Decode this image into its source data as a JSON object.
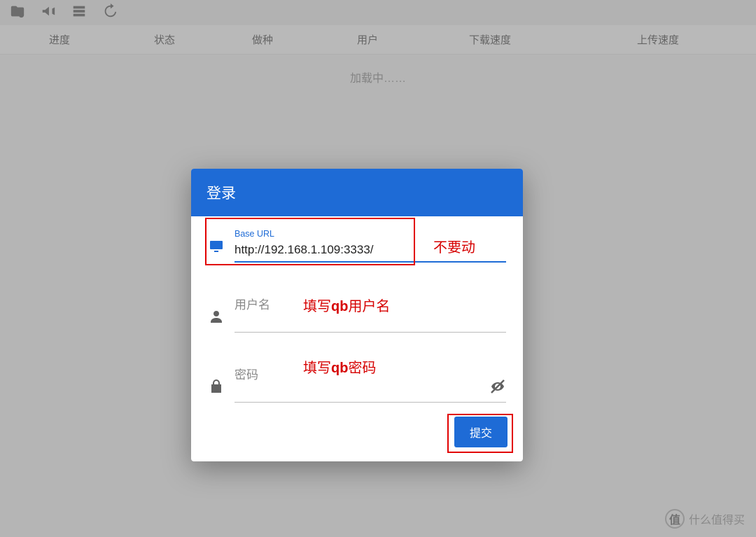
{
  "toolbar": {
    "icons": [
      "folder-pin-icon",
      "megaphone-icon",
      "server-icon",
      "history-icon"
    ]
  },
  "columns": {
    "progress": "进度",
    "status": "状态",
    "seed": "做种",
    "user": "用户",
    "download_speed": "下载速度",
    "upload_speed": "上传速度"
  },
  "loading_text": "加载中……",
  "dialog": {
    "title": "登录",
    "url_field": {
      "label": "Base URL",
      "value": "http://192.168.1.109:3333/"
    },
    "user_field": {
      "label": "用户名",
      "value": ""
    },
    "password_field": {
      "label": "密码",
      "value": ""
    },
    "submit_label": "提交"
  },
  "annotations": {
    "dont_touch": "不要动",
    "fill_user_pre": "填写",
    "fill_user_bold": "qb",
    "fill_user_post": "用户名",
    "fill_pass_pre": "填写",
    "fill_pass_bold": "qb",
    "fill_pass_post": "密码"
  },
  "watermark": {
    "badge": "值",
    "text": "什么值得买"
  }
}
